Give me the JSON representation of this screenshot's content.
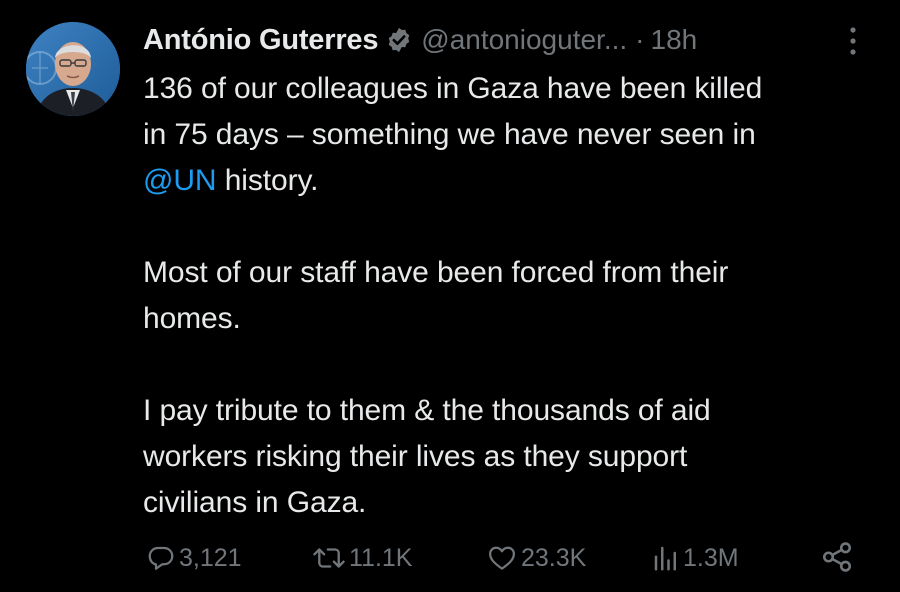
{
  "author": {
    "name": "António Guterres",
    "handle": "@antonioguter...",
    "time": "18h",
    "time_separator": "·",
    "avatar": "avatar-photo",
    "verified_badge": "verified-badge-icon",
    "badge_color": "#71767b"
  },
  "tweet": {
    "line1": "136 of our colleagues in Gaza have been killed",
    "line2": "in 75 days – something we have never seen in",
    "mention": "@UN",
    "line3_rest": " history.",
    "para2_line1": "Most of our staff have been forced from their",
    "para2_line2": "homes.",
    "para3_line1": "I pay tribute to them & the thousands of aid",
    "para3_line2": "workers risking their lives as they support",
    "para3_line3": "civilians in Gaza."
  },
  "actions": {
    "replies": "3,121",
    "reposts": "11.1K",
    "likes": "23.3K",
    "views": "1.3M",
    "reply_icon": "reply-icon",
    "repost_icon": "repost-icon",
    "like_icon": "heart-icon",
    "views_icon": "views-chart-icon",
    "share_icon": "share-icon",
    "more_icon": "more-vertical-icon"
  },
  "colors": {
    "background": "#000000",
    "text": "#e7e9ea",
    "secondary": "#71767b",
    "accent": "#1d9bf0"
  }
}
